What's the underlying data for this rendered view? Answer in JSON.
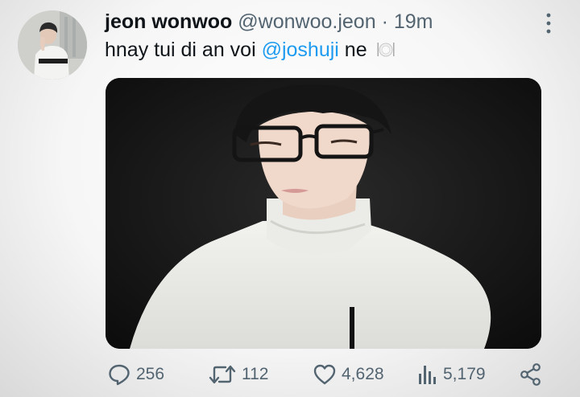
{
  "tweet": {
    "author_name": "jeon wonwoo",
    "handle": "@wonwoo.jeon",
    "separator": "·",
    "time": "19m",
    "text_before": "hnay tui di an voi",
    "mention": "@joshuji",
    "text_after": "ne",
    "emoji": "plate-cutlery-icon"
  },
  "actions": {
    "replies": "256",
    "retweets": "112",
    "likes": "4,628",
    "views": "5,179"
  },
  "colors": {
    "mention": "#1d9bf0",
    "secondary_text": "#536471",
    "primary_text": "#0f1419"
  }
}
